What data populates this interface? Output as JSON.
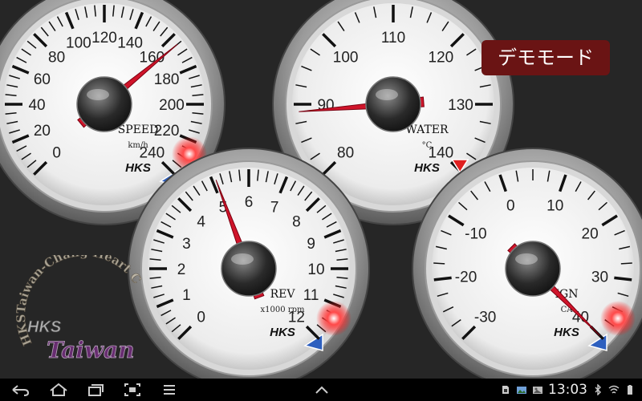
{
  "demo_mode_label": "デモモード",
  "brand": "HKS",
  "watermark": {
    "line1": "HKSTaiwan-Chang Heart Corp",
    "brand": "HKS",
    "script": "Taiwan"
  },
  "gauges": [
    {
      "id": "speed",
      "title": "SPEED",
      "unit": "km/h",
      "labels": [
        "0",
        "20",
        "40",
        "60",
        "80",
        "100",
        "120",
        "140",
        "160",
        "180",
        "200",
        "220",
        "240"
      ],
      "min": 0,
      "max": 240,
      "value": 165,
      "warning_light": true,
      "red_marker": false
    },
    {
      "id": "water",
      "title": "WATER",
      "unit": "°C",
      "labels": [
        "80",
        "90",
        "100",
        "110",
        "120",
        "130",
        "140"
      ],
      "min": 80,
      "max": 140,
      "value": 89,
      "warning_light": false,
      "red_marker": true
    },
    {
      "id": "rev",
      "title": "REV",
      "unit": "x1000 rpm",
      "labels": [
        "0",
        "1",
        "2",
        "3",
        "4",
        "5",
        "6",
        "7",
        "8",
        "9",
        "10",
        "11",
        "12"
      ],
      "min": 0,
      "max": 12,
      "value": 5.1,
      "warning_light": true,
      "red_marker": false
    },
    {
      "id": "ign",
      "title": "IGN",
      "unit": "CA",
      "labels": [
        "-30",
        "-20",
        "-10",
        "0",
        "10",
        "20",
        "30",
        "40"
      ],
      "min": -30,
      "max": 40,
      "value": 40,
      "warning_light": true,
      "red_marker": false
    }
  ],
  "status_bar": {
    "time": "13:03"
  }
}
